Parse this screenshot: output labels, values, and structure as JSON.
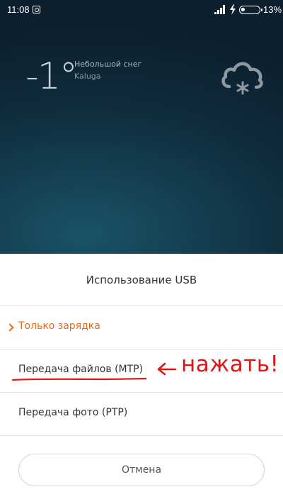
{
  "status_bar": {
    "time": "11:08",
    "battery_percent": "13%",
    "battery_level": 0.13
  },
  "weather": {
    "temperature": "-1°",
    "condition": "Небольшой снег",
    "city": "Kaluga",
    "icon": "snow-cloud-icon"
  },
  "dialog": {
    "title": "Использование USB",
    "options": [
      {
        "label": "Только зарядка",
        "selected": true
      },
      {
        "label": "Передача файлов (MTP)",
        "selected": false
      },
      {
        "label": "Передача фото (PTP)",
        "selected": false
      }
    ],
    "cancel_label": "Отмена"
  },
  "annotation": {
    "text": "нажать!",
    "color": "#e01616"
  },
  "colors": {
    "accent": "#e8691c",
    "annotation": "#e01616"
  }
}
